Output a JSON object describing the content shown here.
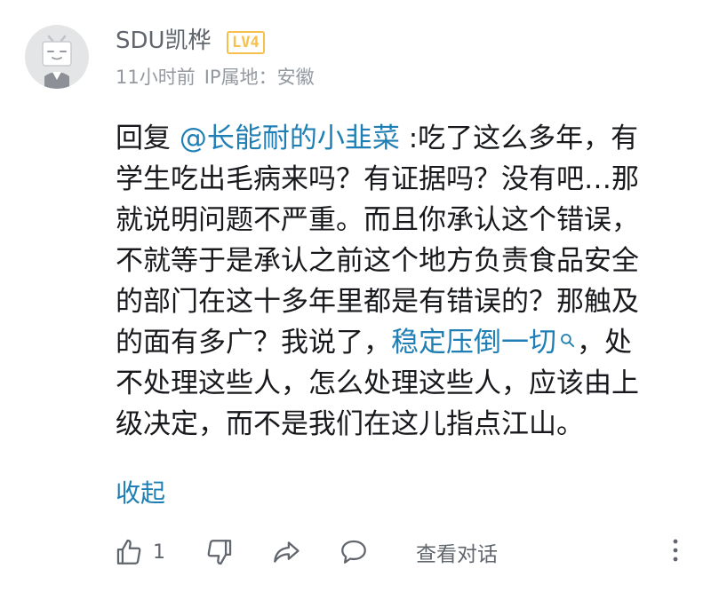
{
  "user": {
    "name": "SDU凯桦",
    "level": "LV4",
    "time": "11小时前",
    "ip": "IP属地：安徽"
  },
  "comment": {
    "lines": [
      {
        "segments": [
          {
            "text": "回复 "
          },
          {
            "text": "@长能耐的小韭菜",
            "link": true
          },
          {
            "text": " :吃了这么多年，有"
          }
        ]
      },
      {
        "segments": [
          {
            "text": "学生吃出毛病来吗？有证据吗？没有吧…那"
          }
        ]
      },
      {
        "segments": [
          {
            "text": "就说明问题不严重。而且你承认这个错误，"
          }
        ]
      },
      {
        "segments": [
          {
            "text": "不就等于是承认之前这个地方负责食品安全"
          }
        ]
      },
      {
        "segments": [
          {
            "text": "的部门在这十多年里都是有错误的？那触及"
          }
        ]
      },
      {
        "segments": [
          {
            "text": "的面有多广？我说了，"
          },
          {
            "text": "稳定压倒一切",
            "link": true,
            "search_icon": true
          },
          {
            "text": "，处"
          }
        ]
      },
      {
        "segments": [
          {
            "text": "不处理这些人，怎么处理这些人，应该由上"
          }
        ]
      },
      {
        "segments": [
          {
            "text": "级决定，而不是我们在这儿指点江山。"
          }
        ]
      }
    ],
    "collapse_label": "收起"
  },
  "actions": {
    "like_count": "1",
    "view_conversation_label": "查看对话"
  },
  "colors": {
    "link": "#1f7fb5",
    "level_badge": "#f5c14c",
    "meta_text": "#9499a0"
  }
}
